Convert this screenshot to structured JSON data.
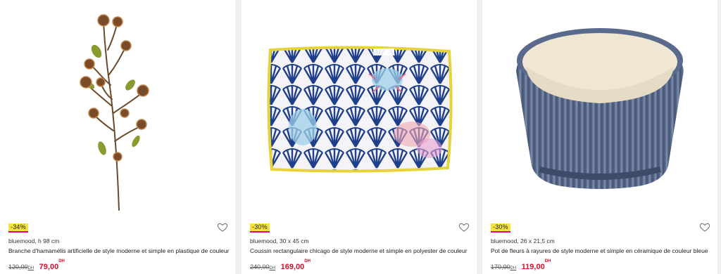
{
  "products": [
    {
      "badge": "-34%",
      "brand_line": "bluemood, h 98 cm",
      "title": "Branche d'hamamélis artificielle de style moderne et simple en plastique de couleur",
      "old_price": "120,00",
      "old_currency": "DH",
      "new_price": "79,00",
      "new_currency": "DH",
      "image": "artificial-witch-hazel-branch",
      "wishlist_icon": "heart-icon"
    },
    {
      "badge": "-30%",
      "brand_line": "bluemood, 30 x 45 cm",
      "title": "Coussin rectangulaire chicago de style moderne et simple en polyester de couleur",
      "old_price": "240,00",
      "old_currency": "DH",
      "new_price": "169,00",
      "new_currency": "DH",
      "image": "blue-patterned-cushion",
      "wishlist_icon": "heart-icon"
    },
    {
      "badge": "-30%",
      "brand_line": "bluemood, 26 x 21,5 cm",
      "title": "Pot de fleurs à rayures de style moderne et simple en céramique de couleur bleue",
      "old_price": "170,00",
      "old_currency": "DH",
      "new_price": "119,00",
      "new_currency": "DH",
      "image": "blue-ceramic-flower-pot",
      "wishlist_icon": "heart-icon"
    }
  ],
  "colors": {
    "badge_bg": "#f5e33b",
    "badge_underline": "#e6007e",
    "sale_price": "#d4102a"
  }
}
